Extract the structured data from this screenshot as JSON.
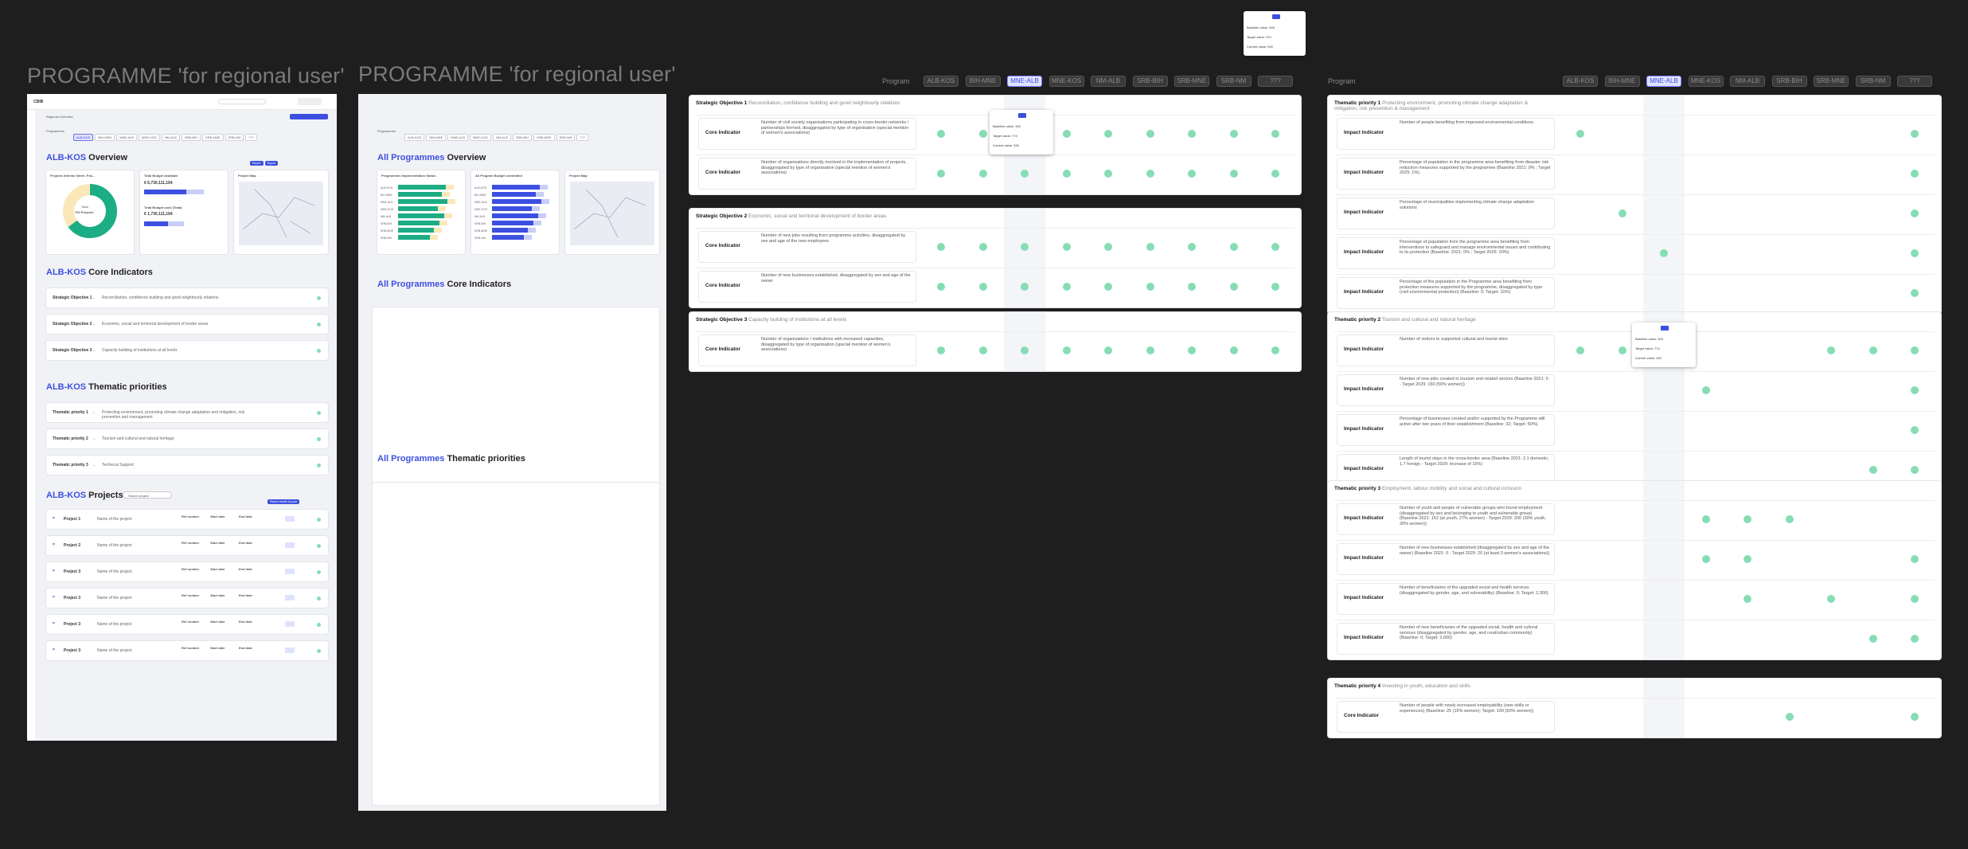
{
  "frames": {
    "left1_title": "PROGRAMME 'for regional user'",
    "left2_title": "PROGRAMME 'for regional user'"
  },
  "ab1": {
    "logo": "CBIB",
    "nav": "Regional Overview",
    "programmes_label": "Programmes",
    "program_tabs": [
      "ALB-KOS",
      "BIH-MNE",
      "MNE-ALB",
      "MNE-KOS",
      "NM-ALB",
      "SRB-BIH",
      "SRB-MNE",
      "SRB-NM",
      "???"
    ],
    "overview_prefix": "ALB-KOS",
    "overview_suffix": "Overview",
    "donut_title": "Projects Interim/ Intern. Pos...",
    "donut_total": "Total:",
    "donut_value": "700 Projects",
    "budget_title": "Total Budget Available",
    "budget_value1": "€ 6,730,111,194",
    "budget_sub": "Total Budget used (Total)",
    "budget_value2": "€ 1,730,111,194",
    "map_title": "Project Map",
    "core_prefix": "ALB-KOS",
    "core_suffix": "Core Indicators",
    "core_rows": [
      {
        "label": "Strategic Objective 1",
        "text": "Reconciliation, confidence building and good neighbourly relations"
      },
      {
        "label": "Strategic Objective 2",
        "text": "Economic, social and territorial development of border areas"
      },
      {
        "label": "Strategic Objective 3",
        "text": "Capacity building of institutions at all levels"
      }
    ],
    "thematic_prefix": "ALB-KOS",
    "thematic_suffix": "Thematic priorities",
    "thematic_rows": [
      {
        "label": "Thematic priority 1",
        "text": "Protecting environment, promoting climate change adaptation and mitigation, risk prevention and management"
      },
      {
        "label": "Thematic priority 2",
        "text": "Tourism and cultural and natural heritage"
      },
      {
        "label": "Thematic priority 3",
        "text": "Technical Support"
      }
    ],
    "projects_prefix": "ALB-KOS",
    "projects_suffix": "Projects",
    "search_placeholder": "Search project",
    "project_rows": [
      {
        "id": "Project 1",
        "name": "Name of the project"
      },
      {
        "id": "Project 2",
        "name": "Name of the project"
      },
      {
        "id": "Project 3",
        "name": "Name of the project"
      },
      {
        "id": "Project 3",
        "name": "Name of the project"
      },
      {
        "id": "Project 3",
        "name": "Name of the project"
      },
      {
        "id": "Project 3",
        "name": "Name of the project"
      }
    ],
    "project_cols": [
      "Ref number",
      "Start date",
      "End date"
    ],
    "report_btn": "Report results by year"
  },
  "ab2": {
    "programmes_label": "Programmes",
    "overview_prefix": "All Programmes",
    "overview_suffix": "Overview",
    "chart1_title": "Programmes Implementation Status",
    "chart2_title": "All Program Budget committed",
    "map_title": "Project Map",
    "core_prefix": "All Programmes",
    "core_suffix": "Core Indicators",
    "thematic_prefix": "All Programmes",
    "thematic_suffix": "Thematic priorities",
    "bar_labels": [
      "ALB-KOS",
      "BIH-MNE",
      "MNE-ALB",
      "MNE-KOS",
      "NM-ALB",
      "SRB-BIH",
      "SRB-MNE",
      "SRB-NM"
    ]
  },
  "ab3": {
    "program_label": "Program",
    "tabs": [
      "ALB-KOS",
      "BIH-MNE",
      "MNE-ALB",
      "MNE-KOS",
      "NM-ALB",
      "SRB-BIH",
      "SRB-MNE",
      "SRB-NM",
      "???"
    ],
    "sections": [
      {
        "label": "Strategic Objective 1",
        "text": "Reconciliation, confidence building and good neighbourly relations",
        "rows": [
          {
            "type": "Core Indicator",
            "text": "Number of civil society organisations participating in cross-border networks / partnerships formed, disaggregated by type of organisation (special mention of women's associations)"
          },
          {
            "type": "Core Indicator",
            "text": "Number of organisations directly involved in the implementation of projects, disaggregated by type of organisation (special mention of women's associations)"
          }
        ]
      },
      {
        "label": "Strategic Objective 2",
        "text": "Economic, social and territorial development of border areas",
        "rows": [
          {
            "type": "Core Indicator",
            "text": "Number of new jobs resulting from programme activities, disaggregated by sex and age of the new employees"
          },
          {
            "type": "Core Indicator",
            "text": "Number of new businesses established, disaggregated by sex and age of the owner"
          }
        ]
      },
      {
        "label": "Strategic Objective 3",
        "text": "Capacity building of institutions at all levels",
        "rows": [
          {
            "type": "Core Indicator",
            "text": "Number of organisations / institutions with increased capacities, disaggregated by type of organisation (special mention of women's associations)"
          }
        ]
      }
    ],
    "tooltip": {
      "baseline": "Baseline value: 300",
      "target": "Target value: 774",
      "current": "Current value: 320"
    }
  },
  "ab4": {
    "program_label": "Program",
    "tabs": [
      "ALB-KOS",
      "BIH-MNE",
      "MNE-ALB",
      "MNE-KOS",
      "NM-ALB",
      "SRB-BIH",
      "SRB-MNE",
      "SRB-NM",
      "???"
    ],
    "sections": [
      {
        "label": "Thematic priority 1",
        "text": "Protecting environment, promoting climate change adaptation & mitigation, risk prevention & management",
        "rows": [
          {
            "type": "Impact Indicator",
            "text": "Number of people benefiting from improved environmental conditions"
          },
          {
            "type": "Impact Indicator",
            "text": "Percentage of population in the programme area benefiting from disaster risk reduction measures supported by the programme (Baseline 2021: 0% ; Target 2029: 1%)"
          },
          {
            "type": "Impact Indicator",
            "text": "Percentage of municipalities implementing climate change adaptation solutions"
          },
          {
            "type": "Impact Indicator",
            "text": "Percentage of population from the programme area benefiting from interventions to safeguard and manage environmental issues and contributing to its protection (Baseline: 2021: 0% ; Target 2029: 20%)"
          },
          {
            "type": "Impact Indicator",
            "text": "Percentage of the population in the Programme area benefiting from protection measures supported by the programme, disaggregated by type (civil environmental protection) (Baseline: 0; Target: 10%)"
          }
        ]
      },
      {
        "label": "Thematic priority 2",
        "text": "Tourism and cultural and natural heritage",
        "rows": [
          {
            "type": "Impact Indicator",
            "text": "Number of visitors to supported cultural and tourist sites"
          },
          {
            "type": "Impact Indicator",
            "text": "Number of new jobs created in tourism and related sectors (Baseline 2021: 0 - Target 2029: 150 (50% women))"
          },
          {
            "type": "Impact Indicator",
            "text": "Percentage of businesses created and/or supported by the Programme still active after two years of their establishment (Baseline: 32; Target: 50%)"
          },
          {
            "type": "Impact Indicator",
            "text": "Length of tourist stays in the cross-border area (Baseline 2021: 2,1 domestic; 1,7 foreign - Target 2029: increase of 15%)"
          }
        ]
      },
      {
        "label": "Thematic priority 3",
        "text": "Employment, labour mobility and social and cultural inclusion",
        "rows": [
          {
            "type": "Impact Indicator",
            "text": "Number of youth and people of vulnerable groups who found employment (disaggregated by sex and belonging to youth and vulnerable group) (Baseline 2021: 152 (at youth, 27% women) - Target 2029: 200 (30% youth, 30% women))"
          },
          {
            "type": "Impact Indicator",
            "text": "Number of new businesses established (disaggregated by sex and age of the owner) (Baseline 2021: 0 - Target 2029: 20 (at least 3 women's associations))"
          },
          {
            "type": "Impact Indicator",
            "text": "Number of beneficiaries of the upgraded social and health services (disaggregated by gender, age, and vulnerability) (Baseline: 0; Target: 2,300)"
          },
          {
            "type": "Impact Indicator",
            "text": "Number of new beneficiaries of the upgraded social, health and cultural services (disaggregated by gender, age, and rural/urban community) (Baseline: 0; Target: 2,000)"
          }
        ]
      },
      {
        "label": "Thematic priority 4",
        "text": "Investing in youth, education and skills",
        "rows": [
          {
            "type": "Core Indicator",
            "text": "Number of people with newly increased employability (new skills or experiences) (Baseline: 25 (15% women); Target: 100 (50% women))"
          }
        ]
      }
    ],
    "tooltip": {
      "baseline": "Baseline value: 300",
      "target": "Target value: 774",
      "current": "Current value: 320"
    }
  },
  "floating_tooltip": {
    "baseline": "Baseline value: 300",
    "target": "Target value: 470",
    "current": "Current value: 520"
  },
  "colors": {
    "accent": "#3d4fe0",
    "dot": "#86ddb4",
    "bg": "#1e1e1e",
    "artboard": "#f1f2f5"
  }
}
